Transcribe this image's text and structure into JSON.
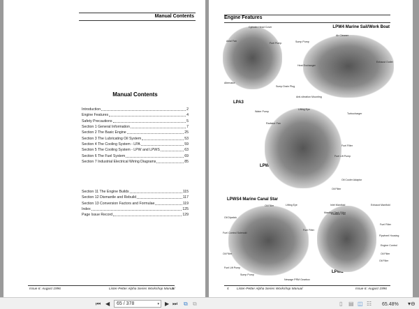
{
  "left_page": {
    "header": "Manual Contents",
    "title": "Manual Contents",
    "toc_group1": [
      {
        "title": "Introduction",
        "page": "2"
      },
      {
        "title": "Engine Features",
        "page": "4"
      },
      {
        "title": "Safety Precautions",
        "page": "5"
      },
      {
        "title": "Section 1 General Information",
        "page": "7"
      },
      {
        "title": "Section 2 The Basic Engine",
        "page": "25"
      },
      {
        "title": "Section 3 The Lubricating Oil System",
        "page": "53"
      },
      {
        "title": "Section 4 The Cooling System - LPA",
        "page": "59"
      },
      {
        "title": "Section 5 The Cooling System - LPW and LPWS",
        "page": "63"
      },
      {
        "title": "Section 6 The Fuel System",
        "page": "69"
      },
      {
        "title": "Section 7 Industrial Electrical Wiring Diagrams",
        "page": "85"
      }
    ],
    "toc_group2": [
      {
        "title": "Section 11 The Engine Builds",
        "page": "115"
      },
      {
        "title": "Section 12 Dismantle and Rebuild",
        "page": "117"
      },
      {
        "title": "Section 13 Conversion Factors and Formulae",
        "page": "119"
      },
      {
        "title": "Index",
        "page": "125"
      },
      {
        "title": "Page Issue Record",
        "page": "129"
      }
    ],
    "footer_left": "Issue 6: August 1996",
    "footer_right": "Lister-Petter Alpha Series Workshop Manual",
    "page_number": "3"
  },
  "right_page": {
    "header": "Engine Features",
    "models": {
      "lpa3": "LPA3",
      "lpw4": "LPW4 Marine Sail/Work Boat",
      "lpwt4": "LPWT4",
      "lpws4": "LPWS4 Marine Canal Star",
      "lpw2": "LPW2"
    },
    "labels": [
      "Cylinder Head Cover",
      "Axial Fan",
      "Fuel Pump",
      "Alternator",
      "Sump Drain Plug",
      "Sump Pump",
      "Air Cleaner",
      "Heat Exchanger",
      "Exhaust Outlet",
      "Anti-vibration Mounting",
      "Water Pump",
      "Lifting Eye",
      "Turbocharger",
      "Radiator Fan",
      "Fuel Filter",
      "Fuel Lift Pump",
      "Oil Cooler Adaptor",
      "Oil Filter",
      "Oil Filler",
      "Lifting Eye",
      "Oil Dipstick",
      "Manifold Tank Filler",
      "Fuel Control Solenoid",
      "Fuel Filter",
      "Oil Filler",
      "Fuel Lift Pump",
      "Sump Pump",
      "Newage PRM Gearbox",
      "Inlet Manifold",
      "Exhaust Manifold",
      "Radiator Fan",
      "Fuel Filter",
      "Flywheel Housing",
      "Engine Control",
      "Oil Filter",
      "Oil Filler"
    ],
    "page_number": "4",
    "footer_left": "Lister-Petter Alpha Series Workshop Manual",
    "footer_right": "Issue 6: August 1996"
  },
  "toolbar": {
    "page_field": "65 / 378",
    "zoom": "65.48%"
  }
}
